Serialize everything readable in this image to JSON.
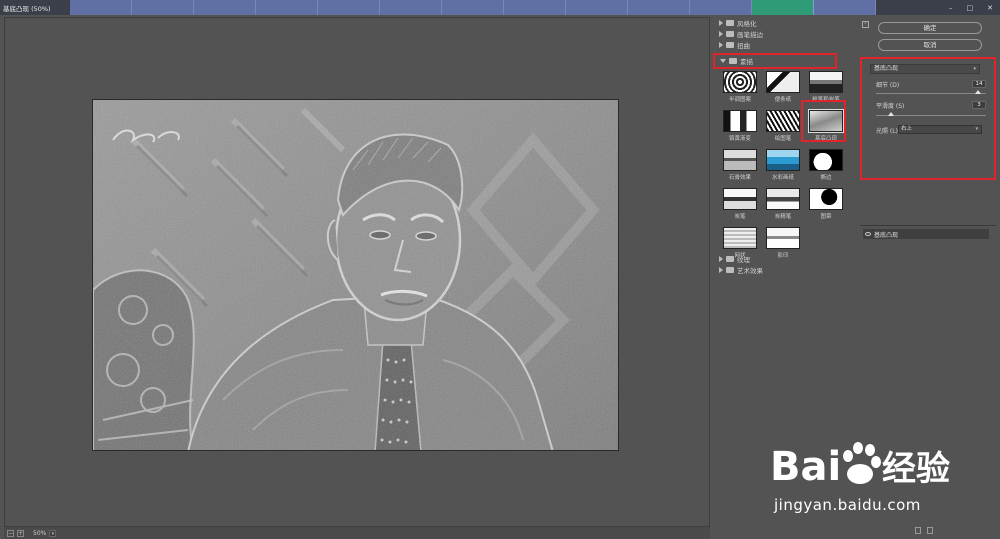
{
  "window": {
    "title": "基底凸现 (50%)",
    "tabs": [
      "",
      "",
      "",
      "",
      "",
      "",
      "",
      "",
      "",
      "",
      "",
      "",
      ""
    ],
    "controls": [
      "–",
      "□",
      "✕"
    ]
  },
  "preview": {
    "zoom": "50%",
    "zoom_out_icon": "minus-icon",
    "zoom_in_icon": "plus-icon"
  },
  "gallery": {
    "folders_top": [
      "风格化",
      "画笔描边",
      "扭曲"
    ],
    "open_folder": "素描",
    "thumbnails": [
      {
        "label": "半调图案"
      },
      {
        "label": "便条纸"
      },
      {
        "label": "粉笔和炭笔"
      },
      {
        "label": "铬黄渐变"
      },
      {
        "label": "绘图笔"
      },
      {
        "label": "基底凸现"
      },
      {
        "label": "石膏效果"
      },
      {
        "label": "水彩画纸"
      },
      {
        "label": "撕边"
      },
      {
        "label": "炭笔"
      },
      {
        "label": "炭精笔"
      },
      {
        "label": "图章"
      },
      {
        "label": "网状"
      },
      {
        "label": "影印"
      }
    ],
    "selected_index": 5,
    "folders_bottom": [
      "纹理",
      "艺术效果"
    ]
  },
  "panel": {
    "collapse_icon": "collapse-icon",
    "ok_label": "确定",
    "cancel_label": "取消",
    "filter_select": "基底凸现",
    "detail_label": "细节 (D)",
    "detail_value": "14",
    "detail_fraction": 0.93,
    "smooth_label": "平滑度 (S)",
    "smooth_value": "3",
    "smooth_fraction": 0.14,
    "light_label": "光照 (L)",
    "light_value": "右上",
    "layer_name": "基底凸现"
  },
  "watermark": {
    "brand": "Bai",
    "brand_suffix": "经验",
    "url": "jingyan.baidu.com"
  },
  "colors": {
    "highlight_red": "#e0242c",
    "panel_bg": "#535353",
    "active_tab": "#2f9c77"
  }
}
